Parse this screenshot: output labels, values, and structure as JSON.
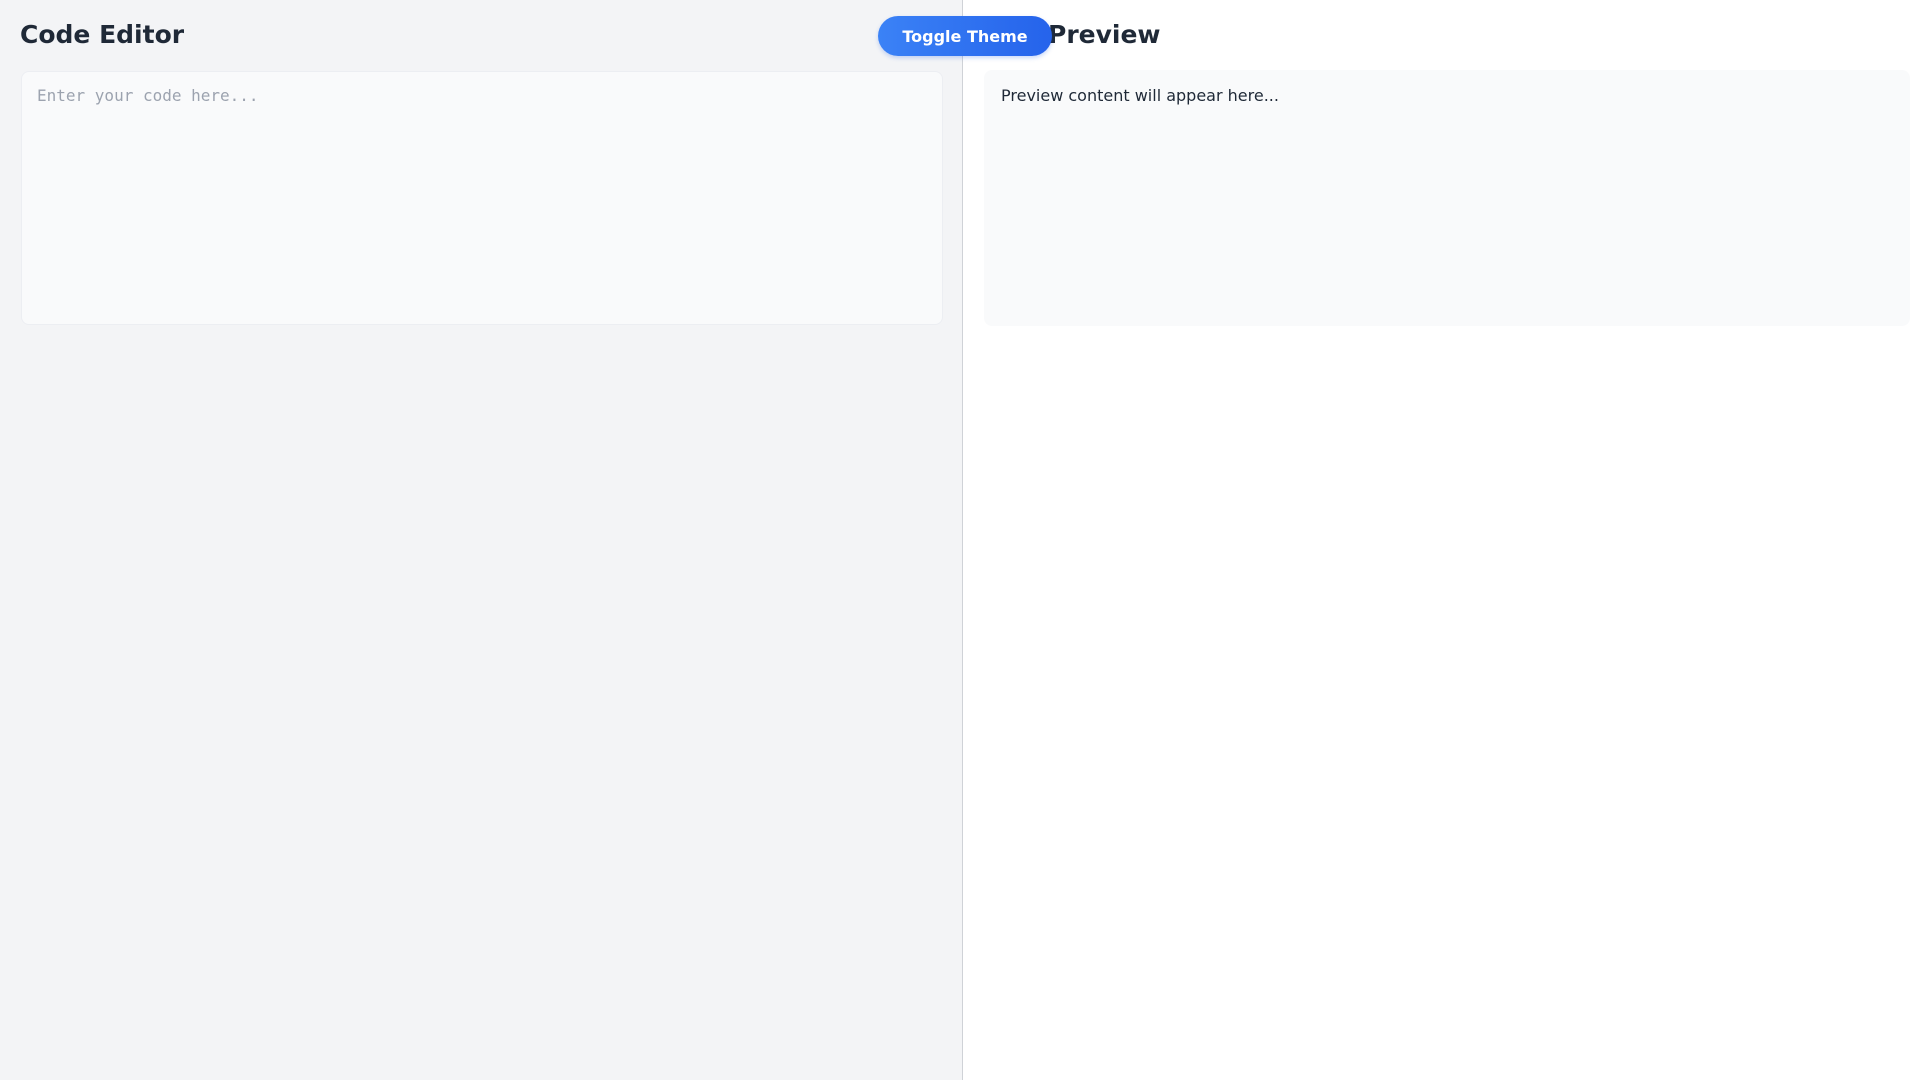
{
  "editor": {
    "title": "Code Editor",
    "input_value": "",
    "input_placeholder": "Enter your code here..."
  },
  "toolbar": {
    "toggle_theme_label": "Toggle Theme"
  },
  "preview": {
    "title": "Preview",
    "content": "Preview content will appear here..."
  },
  "colors": {
    "accent": "#3b82f6",
    "accent_dark": "#2563eb",
    "editor_background": "#f3f4f6",
    "preview_background": "#ffffff",
    "panel_background": "#f9fafb",
    "heading_text": "#1f2937",
    "placeholder_text": "#9ca3af"
  }
}
